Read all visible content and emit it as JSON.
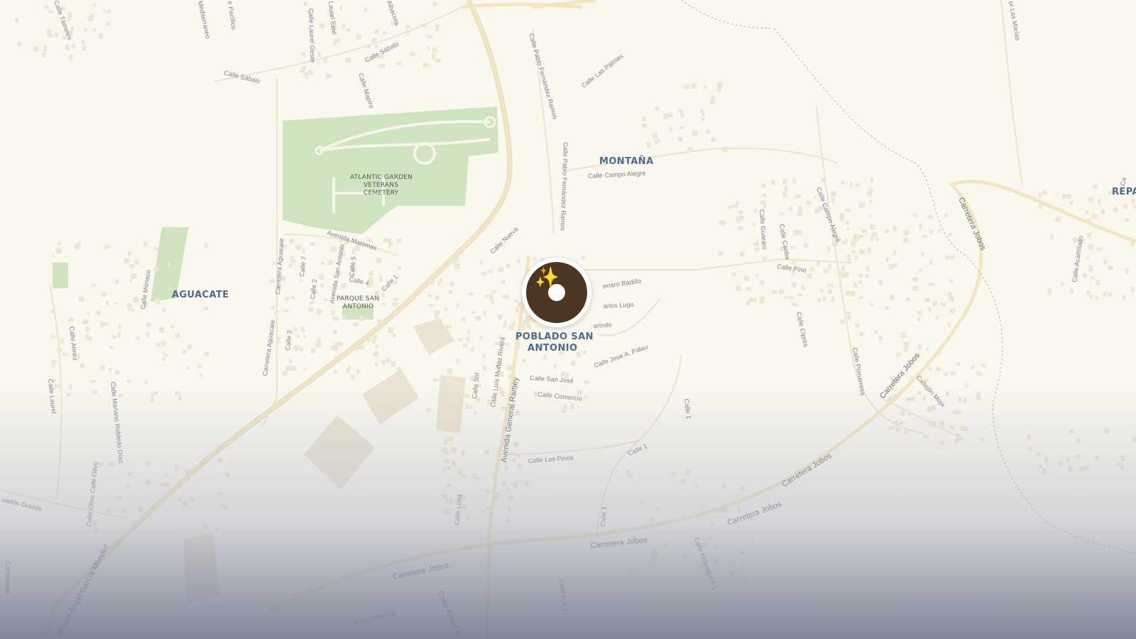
{
  "map": {
    "areas": {
      "aguacate": "AGUACATE",
      "montana": "MONTAÑA",
      "poblado_line1": "POBLADO SAN",
      "poblado_line2": "ANTONIO",
      "repa": "REPA"
    },
    "pois": {
      "cemetery_line1": "ATLANTIC GARDEN",
      "cemetery_line2": "VETERANS",
      "cemetery_line3": "CEMETERY",
      "parque_line1": "PARQUE SAN",
      "parque_line2": "ANTONIO"
    },
    "streets": {
      "tamesis": "Calle Támesis",
      "mediterraneo": "Mediterráneo",
      "pacifico": "e Pacífico",
      "laurel_oeste": "Calle Laurel Oeste",
      "laurel_este": "Laurel Este",
      "albacora": "Albacora",
      "sabalo_w": "Calle Sábalo",
      "sabalo_e": "Calle Sábalo",
      "mapiro": "Calle Mapiro",
      "pablo_fernandez_n": "Calle Pablo Fernández Ramos",
      "pablo_fernandez_s": "Calle Pablo Fernández Ramos",
      "las_palmas": "Calle Las Palmas",
      "las_marias": "or Las Marías",
      "campo_alegre_h": "Calle Campo Alegre",
      "campo_alegre_v": "Calle Campo Alegre",
      "avenida_matomas": "Avenida Matomas",
      "calle_nueva": "Calle Nueva",
      "aguacate_n": "Carretera Aguacate",
      "aguacate_s": "Carretera Aguacate",
      "calle_7": "Calle 7",
      "calle_2": "Calle 2",
      "avenida_san_antonio": "Avenida San Antonio",
      "calle_5": "Calle 5",
      "calle_4": "Calle 4",
      "calle_1a": "Calle 1",
      "calle_3": "Calle 3",
      "monaco": "Calle Mónaco",
      "genaro_badillo": "enaro Badillo",
      "carlos_lugo": "arlos Lugo",
      "marindo": "arindo",
      "jose_palau": "Calle Jose A. Palau",
      "calle_sol": "Calle Sol",
      "luis_munoz": "Calle Luis Muñoz Rivera",
      "avenida_ramey": "Avenida General Ramey",
      "san_jose": "Calle San José",
      "comercio": "Calle Comercio",
      "los_pinos": "Calle Los Pinos",
      "calle_1b": "Calle 1",
      "calle_1c": "Calle 1",
      "calle_1d": "Calle 1",
      "guarani": "Calle Guaraní",
      "caoba": "Calle Caoba",
      "pino": "Calle Pino",
      "cipres": "Calle Ciprés",
      "pomarrosa": "Calle Pomarrosa",
      "jobos_ne": "Carretera Jobos",
      "jobos_e": "Carretera Jobos",
      "callejon_moja": "Callejón Moja",
      "jobos_s1": "Carretera Jobos",
      "jobos_s2": "Carretera Jobos",
      "jobos_s3": "Carretera Jobos",
      "jobos_s4": "Carretera Jobos",
      "acantilado": "Calle Acantilado",
      "almez": "Calle Almez",
      "laurel": "Calle Laurel",
      "mariano": "Calle Mariano Robledo Díaz",
      "olivo": "Calle Olivo Calle Olivo",
      "cuadon": "uadón Grande",
      "miguel_angel": "Miguel Ángel García Méndez",
      "luna": "Calle Luna",
      "km81": "Calle Kilómetro 8.1",
      "cepi": "Calle C.E.P.I.",
      "adela": "Calle Adela Al",
      "valencia": "Calle Valencia",
      "continental": "Continental",
      "ca_edge": "Ca"
    },
    "marker": {
      "icon": "sparkles-icon",
      "color": "#4b3624",
      "accent": "#f1c446"
    }
  }
}
